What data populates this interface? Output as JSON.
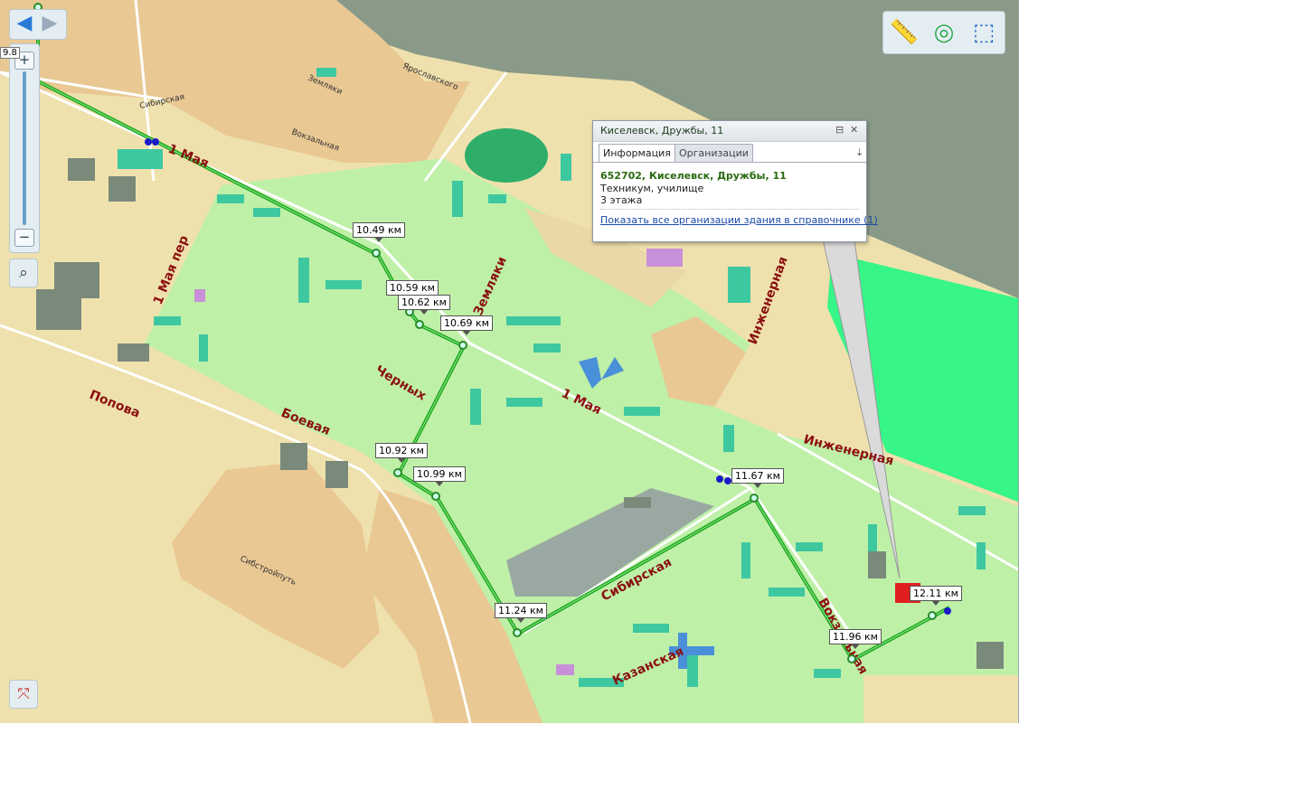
{
  "map": {
    "streets": [
      {
        "id": "st1",
        "label": "1 Мая"
      },
      {
        "id": "st2",
        "label": "1 Мая"
      },
      {
        "id": "st3",
        "label": "1 Мая пер"
      },
      {
        "id": "st4",
        "label": "Земляки"
      },
      {
        "id": "st5",
        "label": "Черных"
      },
      {
        "id": "st6",
        "label": "Боевая"
      },
      {
        "id": "st7",
        "label": "Попова"
      },
      {
        "id": "st8",
        "label": "Инженерная"
      },
      {
        "id": "st9",
        "label": "Инженерная"
      },
      {
        "id": "st10",
        "label": "Казанская"
      },
      {
        "id": "st11",
        "label": "Сибирская"
      },
      {
        "id": "st12",
        "label": "Вокзальная"
      }
    ],
    "small_streets": [
      {
        "id": "ss1",
        "label": "Сибирская"
      },
      {
        "id": "ss2",
        "label": "Вокзальная"
      },
      {
        "id": "ss3",
        "label": "Ярославского"
      },
      {
        "id": "ss4",
        "label": "Сибстройпуть"
      },
      {
        "id": "ss5",
        "label": "Земляки"
      }
    ],
    "distance_markers": [
      "10.49 км",
      "10.59 км",
      "10.62 км",
      "10.69 км",
      "10.92 км",
      "10.99 км",
      "11.24 км",
      "11.67 км",
      "11.96 км",
      "12.11 км"
    ],
    "zoom_label": "9.8",
    "colors": {
      "route": "#1fa81f",
      "residential": "#bff0a8",
      "buildings": "#3ec8a0",
      "sand": "#e9c894",
      "industrial": "#8a9a88",
      "park": "#37f587"
    }
  },
  "controls": {
    "back_icon": "◀",
    "forward_icon": "▶",
    "zoom_in": "+",
    "zoom_out": "−",
    "find_icon": "⌕",
    "fit_icon": "⤧",
    "ruler_icon": "📏",
    "radar_icon": "◎",
    "view3d_icon": "⬚"
  },
  "popup": {
    "title": "Киселевск, Дружбы, 11",
    "tabs": [
      {
        "label": "Информация"
      },
      {
        "label": "Организации"
      }
    ],
    "address": "652702, Киселевск, Дружбы, 11",
    "line1": "Техникум, училище",
    "line2": "3 этажа",
    "link": "Показать все организации здания в справочнике",
    "count": "(1)",
    "pin_icon": "⊟",
    "close_icon": "✕",
    "menu_icon": "⇣"
  }
}
